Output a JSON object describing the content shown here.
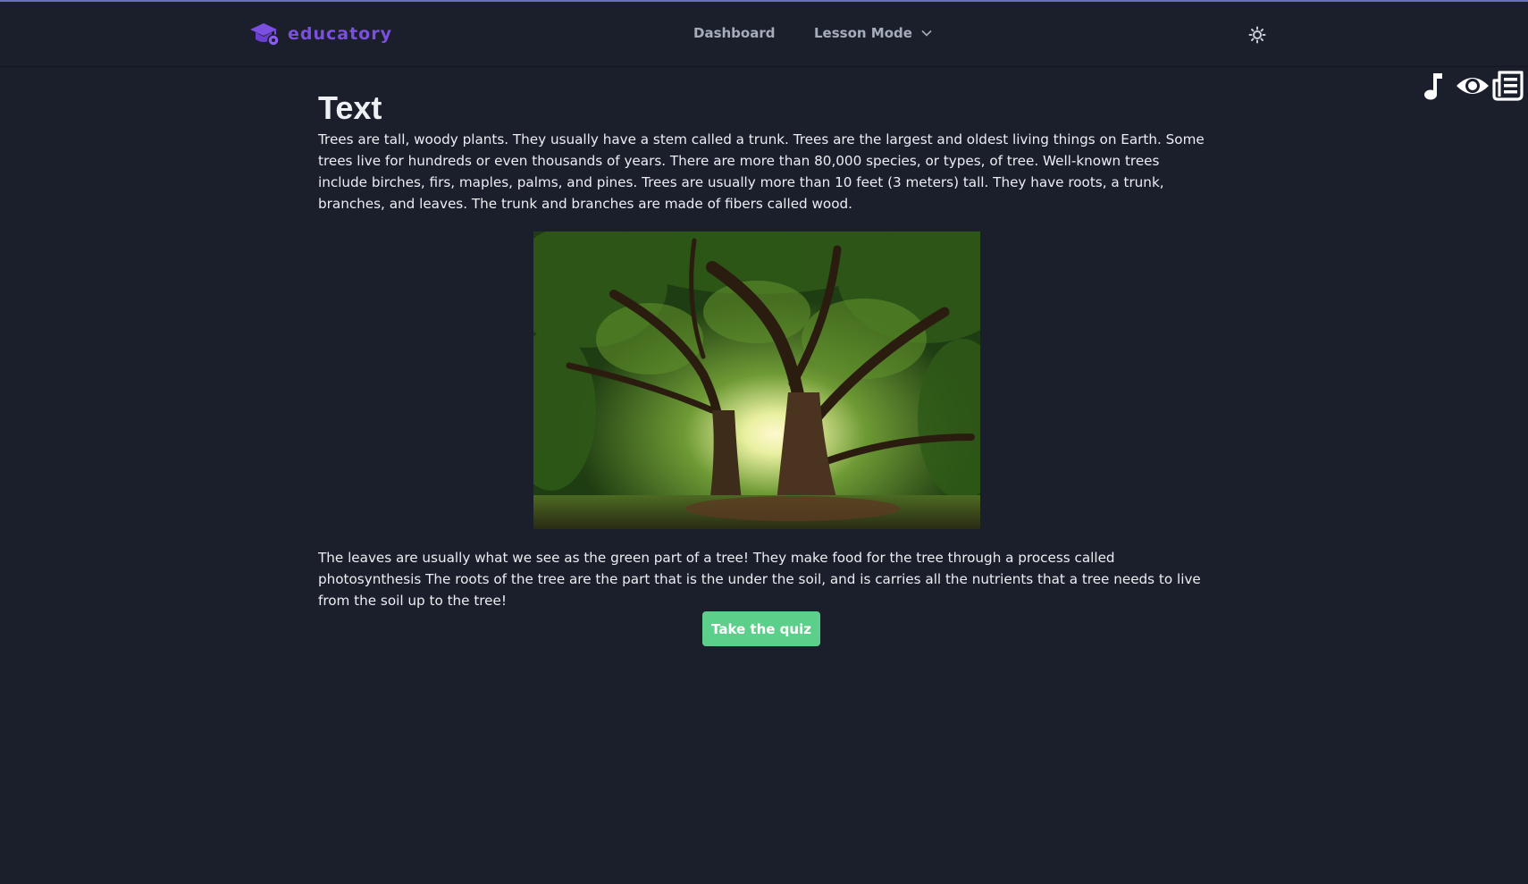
{
  "brand": {
    "name": "educatory",
    "color": "#7b4fe0",
    "logo_icon": "graduation-cap-icon"
  },
  "nav": {
    "dashboard_label": "Dashboard",
    "lesson_mode_label": "Lesson Mode",
    "lesson_mode_icon": "chevron-down-icon",
    "theme_toggle_icon": "sun-icon"
  },
  "tools": {
    "audio_icon": "music-note-icon",
    "view_icon": "eye-icon",
    "text_icon": "newspaper-icon"
  },
  "lesson": {
    "title": "Text",
    "paragraph_1": "Trees are tall, woody plants. They usually have a stem called a trunk. Trees are the largest and oldest living things on Earth. Some trees live for hundreds or even thousands of years. There are more than 80,000 species, or types, of tree. Well-known trees include birches, firs, maples, palms, and pines. Trees are usually more than 10 feet (3 meters) tall. They have roots, a trunk, branches, and leaves. The trunk and branches are made of fibers called wood.",
    "paragraph_2": "The leaves are usually what we see as the green part of a tree! They make food for the tree through a process called photosynthesis The roots of the tree are the part that is the under the soil, and is carries all the nutrients that a tree needs to live from the soil up to the tree!",
    "quiz_button_label": "Take the quiz"
  },
  "colors": {
    "background": "#1b1f2b",
    "accent_green": "#5ccf8b",
    "nav_text": "#a5adbb"
  }
}
